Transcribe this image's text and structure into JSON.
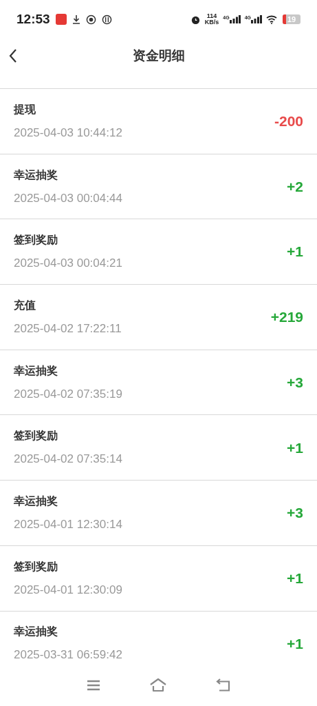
{
  "status_bar": {
    "time": "12:53",
    "speed_value": "114",
    "speed_unit": "KB/s",
    "network_1": "4G",
    "network_2": "4G",
    "battery": "19"
  },
  "header": {
    "title": "资金明细"
  },
  "records": [
    {
      "title": "提现",
      "time": "2025-04-03 10:44:12",
      "amount": "-200",
      "color": "#e84a4a"
    },
    {
      "title": "幸运抽奖",
      "time": "2025-04-03 00:04:44",
      "amount": "+2",
      "color": "#26a83a"
    },
    {
      "title": "签到奖励",
      "time": "2025-04-03 00:04:21",
      "amount": "+1",
      "color": "#26a83a"
    },
    {
      "title": "充值",
      "time": "2025-04-02 17:22:11",
      "amount": "+219",
      "color": "#26a83a"
    },
    {
      "title": "幸运抽奖",
      "time": "2025-04-02 07:35:19",
      "amount": "+3",
      "color": "#26a83a"
    },
    {
      "title": "签到奖励",
      "time": "2025-04-02 07:35:14",
      "amount": "+1",
      "color": "#26a83a"
    },
    {
      "title": "幸运抽奖",
      "time": "2025-04-01 12:30:14",
      "amount": "+3",
      "color": "#26a83a"
    },
    {
      "title": "签到奖励",
      "time": "2025-04-01 12:30:09",
      "amount": "+1",
      "color": "#26a83a"
    },
    {
      "title": "幸运抽奖",
      "time": "2025-03-31 06:59:42",
      "amount": "+1",
      "color": "#26a83a"
    }
  ]
}
